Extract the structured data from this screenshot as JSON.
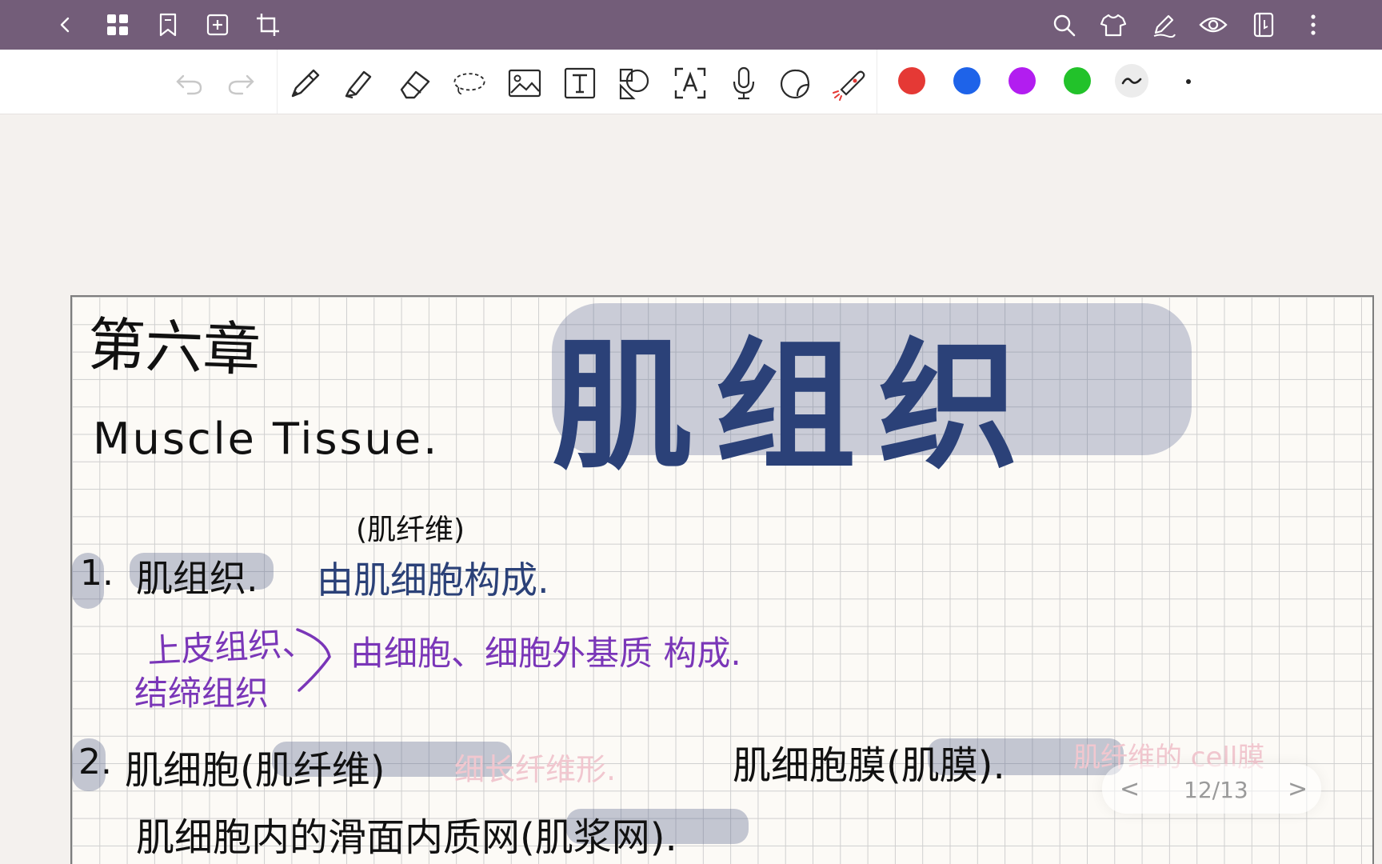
{
  "topbar": {
    "left_icons": [
      "back-icon",
      "grid-icon",
      "bookmark-icon",
      "add-page-icon",
      "crop-icon"
    ],
    "right_icons": [
      "search-icon",
      "shirt-icon",
      "pen-edit-icon",
      "eye-icon",
      "notebook-icon",
      "more-icon"
    ]
  },
  "toolbar": {
    "tools": [
      "undo-icon",
      "redo-icon",
      "pen-icon",
      "highlighter-icon",
      "eraser-icon",
      "lasso-icon",
      "image-icon",
      "text-icon",
      "shapes-icon",
      "text-recognition-icon",
      "microphone-icon",
      "sticker-icon",
      "laser-pointer-icon"
    ],
    "colors": [
      "#e53935",
      "#1e63e9",
      "#b21df0",
      "#22c22a"
    ]
  },
  "note": {
    "chapter": "第六章",
    "title_cn": "肌组织",
    "title_en": "Muscle Tissue.",
    "line1_num": "1.",
    "line1_term": "肌组织.",
    "line1_annot": "(肌纤维)",
    "line1_def": "由肌细胞构成.",
    "line2a": "上皮组织、",
    "line2b": "结缔组织",
    "line2_def": "由细胞、细胞外基质 构成.",
    "line3_num": "2.",
    "line3_text": "肌细胞(肌纤维)",
    "line3_faded": "细长纤维形.",
    "line3_right": "肌细胞膜(肌膜).",
    "line3_right_faded": "肌纤维的 cell膜",
    "line4": "肌细胞内的滑面内质网(肌浆网)."
  },
  "pager": {
    "prev": "<",
    "page": "12/13",
    "next": ">"
  }
}
